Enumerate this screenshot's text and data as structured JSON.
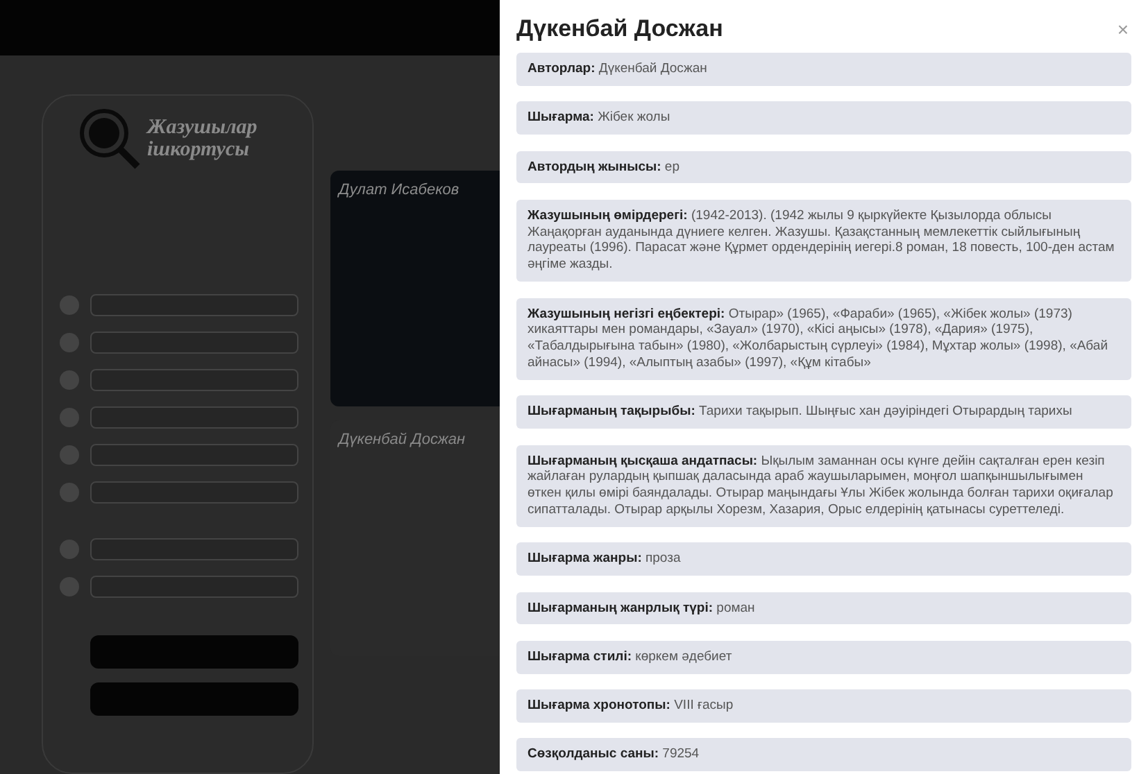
{
  "background": {
    "logo": {
      "lines": [
        "Жазушылар",
        "ішкортусы"
      ]
    },
    "cards": [
      {
        "title": "Дулат Исабеков",
        "dark": true
      },
      {
        "title": "Дүкенбай Досжан",
        "dark": false
      }
    ]
  },
  "modal": {
    "title": "Дүкенбай Досжан",
    "close": "×",
    "fields": [
      {
        "label": "Авторлар:",
        "value": "Дүкенбай Досжан"
      },
      {
        "label": "Шығарма:",
        "value": "Жібек жолы"
      },
      {
        "label": "Автордың жынысы:",
        "value": "ер"
      },
      {
        "label": "Жазушының өмірдерегі:",
        "value": "(1942-2013). (1942 жылы 9 қыркүйекте Қызылорда облысы Жаңақорған ауданында дүниеге келген. Жазушы. Қазақстанның мемлекеттік сыйлығының лауреаты (1996). Парасат және Құрмет ордендерінің иегері.8 роман, 18 повесть, 100-ден астам әңгіме жазды."
      },
      {
        "label": "Жазушының негізгі еңбектері:",
        "value": "Отырар» (1965), «Фараби» (1965), «Жібек жолы» (1973) хикаяттары мен романдары, «Зауал» (1970), «Кісі аңысы» (1978), «Дария» (1975), «Табалдырығына табын» (1980), «Жолбарыстың сүрлеуі» (1984), Мұхтар жолы» (1998), «Абай айнасы» (1994), «Алыптың азабы» (1997), «Құм кітабы»"
      },
      {
        "label": "Шығарманың тақырыбы:",
        "value": "Тарихи тақырып. Шыңғыс хан дәуіріндегі Отырардың тарихы"
      },
      {
        "label": "Шығарманың қысқаша андатпасы:",
        "value": "Ықылым заманнан осы күнге дейін сақталған ерен кезіп жайлаған рулардың қыпшақ даласында араб жаушыларымен, моңғол шапқыншылығымен өткен қилы өмірі баяндалады. Отырар маңындағы Ұлы Жібек жолында болған тарихи оқиғалар сипатталады. Отырар арқылы Хорезм, Хазария, Орыс елдерінің қатынасы суреттеледі."
      },
      {
        "label": "Шығарма жанры:",
        "value": "проза"
      },
      {
        "label": "Шығарманың жанрлық түрі:",
        "value": "роман"
      },
      {
        "label": "Шығарма стилі:",
        "value": "көркем әдебиет"
      },
      {
        "label": "Шығарма хронотопы:",
        "value": "VIII ғасыр"
      },
      {
        "label": "Сөзқолданыс саны:",
        "value": "79254"
      }
    ]
  }
}
